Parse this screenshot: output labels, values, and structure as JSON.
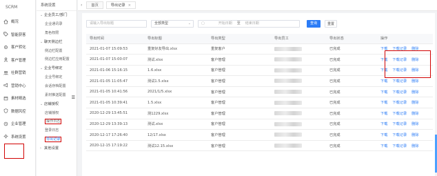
{
  "sidebar": {
    "logo": "SCRM",
    "items": [
      {
        "label": "概况",
        "icon": "home-icon"
      },
      {
        "label": "智能获客",
        "icon": "tag-icon"
      },
      {
        "label": "客户转化",
        "icon": "gear-icon"
      },
      {
        "label": "客户管理",
        "icon": "user-icon"
      },
      {
        "label": "社群营销",
        "icon": "group-icon"
      },
      {
        "label": "营销中心",
        "icon": "megaphone-icon"
      },
      {
        "label": "素材精选",
        "icon": "box-icon"
      },
      {
        "label": "数据风控",
        "icon": "shield-icon"
      },
      {
        "label": "企业管理",
        "icon": "building-icon"
      },
      {
        "label": "系统设置",
        "icon": "settings-icon"
      }
    ]
  },
  "submenu": {
    "header": "系统设置",
    "groups": [
      {
        "label": "企业员工/部门",
        "items": [
          "企业通讯录",
          "角色权限"
        ]
      },
      {
        "label": "聊天侧边栏",
        "items": [
          "侧边栏配置",
          "侧边栏应用配置"
        ]
      },
      {
        "label": "企业号绑定",
        "items": [
          "企业号绑定",
          "会话存档配置",
          "素材推送配置"
        ]
      },
      {
        "label": "店铺授权",
        "items": [
          "店铺授权"
        ]
      },
      {
        "label": "",
        "items": [
          "操作日志",
          "登录日志",
          "导出记录"
        ]
      },
      {
        "label": "其他设置",
        "items": []
      }
    ]
  },
  "tabs": {
    "home": "首页",
    "active": "导出记录"
  },
  "filters": {
    "keyword_placeholder": "请输入导出标题",
    "type_value": "全部类型",
    "start_placeholder": "开始日期",
    "separator": "至",
    "end_placeholder": "结束日期",
    "search_label": "查询",
    "reset_label": "重置"
  },
  "table": {
    "columns": [
      "导出时间",
      "导出标题",
      "导出类型",
      "导出员工",
      "导出状态",
      "操作"
    ],
    "rows": [
      {
        "time": "2021-01-07 15:09:53",
        "title": "重复好友导出.xlsx",
        "type": "重复客户",
        "status": "已完成",
        "ops": [
          "下载",
          "下载记录",
          "删除"
        ]
      },
      {
        "time": "2021-01-07 15:00:07",
        "title": "测试.xlsx",
        "type": "客户管理",
        "status": "已完成",
        "ops": [
          "下载",
          "下载记录",
          "删除"
        ]
      },
      {
        "time": "2021-01-06 15:16:15",
        "title": "1.6.xlsx",
        "type": "客户管理",
        "status": "已完成",
        "ops": [
          "下载",
          "下载记录",
          "删除"
        ]
      },
      {
        "time": "2021-01-05 11:05:47",
        "title": "测试1.5.xlsx",
        "type": "客户管理",
        "status": "已完成",
        "ops": [
          "下载",
          "下载记录",
          "删除"
        ]
      },
      {
        "time": "2021-01-05 10:41:56",
        "title": "2021/1/5.xlsx",
        "type": "客户管理",
        "status": "已完成",
        "ops": [
          "下载",
          "下载记录",
          "删除"
        ]
      },
      {
        "time": "2021-01-05 10:39:41",
        "title": "1.5.xlsx",
        "type": "客户管理",
        "status": "已完成",
        "ops": [
          "下载",
          "下载记录",
          "删除"
        ]
      },
      {
        "time": "2020-12-29 13:45:51",
        "title": "测1229.xlsx",
        "type": "客户管理",
        "status": "已完成",
        "ops": [
          "下载",
          "下载记录",
          "删除"
        ]
      },
      {
        "time": "2020-12-29 13:39:13",
        "title": "测试.xlsx",
        "type": "客户管理",
        "status": "已完成",
        "ops": [
          "下载",
          "下载记录",
          "删除"
        ]
      },
      {
        "time": "2020-12-17 17:26:40",
        "title": "12/17.xlsx",
        "type": "客户管理",
        "status": "已完成",
        "ops": [
          "下载",
          "下载记录",
          "删除"
        ]
      },
      {
        "time": "2020-12-15 17:19:22",
        "title": "测试12.15.xlsx",
        "type": "客户管理",
        "status": "已完成",
        "ops": [
          "下载",
          "下载记录",
          "删除"
        ]
      }
    ]
  },
  "colors": {
    "accent": "#2b7cf6",
    "annotation": "#d10000"
  }
}
